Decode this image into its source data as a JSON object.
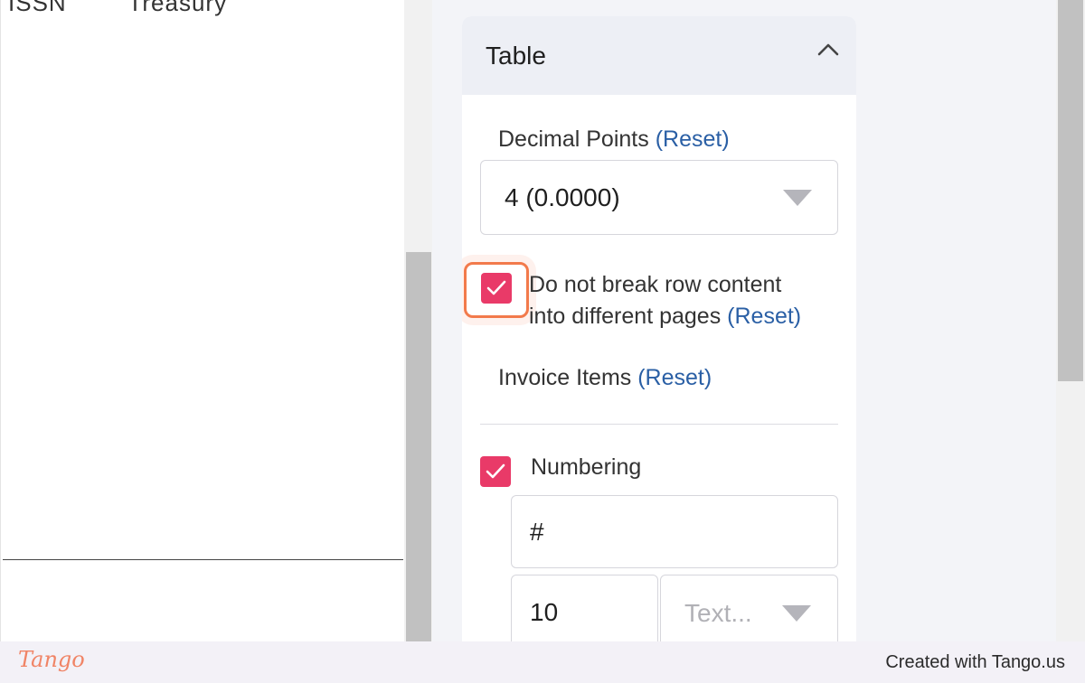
{
  "document": {
    "cut_text_left": "ISSN",
    "cut_text_right": "Treasury"
  },
  "panel": {
    "title": "Table",
    "decimal_points": {
      "label": "Decimal Points",
      "reset": "(Reset)",
      "selected": "4 (0.0000)"
    },
    "break_rows": {
      "checked": true,
      "label_line1": "Do not break row content",
      "label_line2": "into different pages",
      "reset": "(Reset)"
    },
    "invoice_items": {
      "label": "Invoice Items",
      "reset": "(Reset)"
    },
    "numbering": {
      "checked": true,
      "label": "Numbering",
      "header_value": "#",
      "width_value": "10",
      "align_placeholder": "Text..."
    }
  },
  "colors": {
    "accent_checkbox": "#e93a68",
    "highlight": "#f27a4b",
    "link": "#2a5fa5"
  },
  "footer": {
    "logo": "Tango",
    "credit": "Created with Tango.us"
  }
}
